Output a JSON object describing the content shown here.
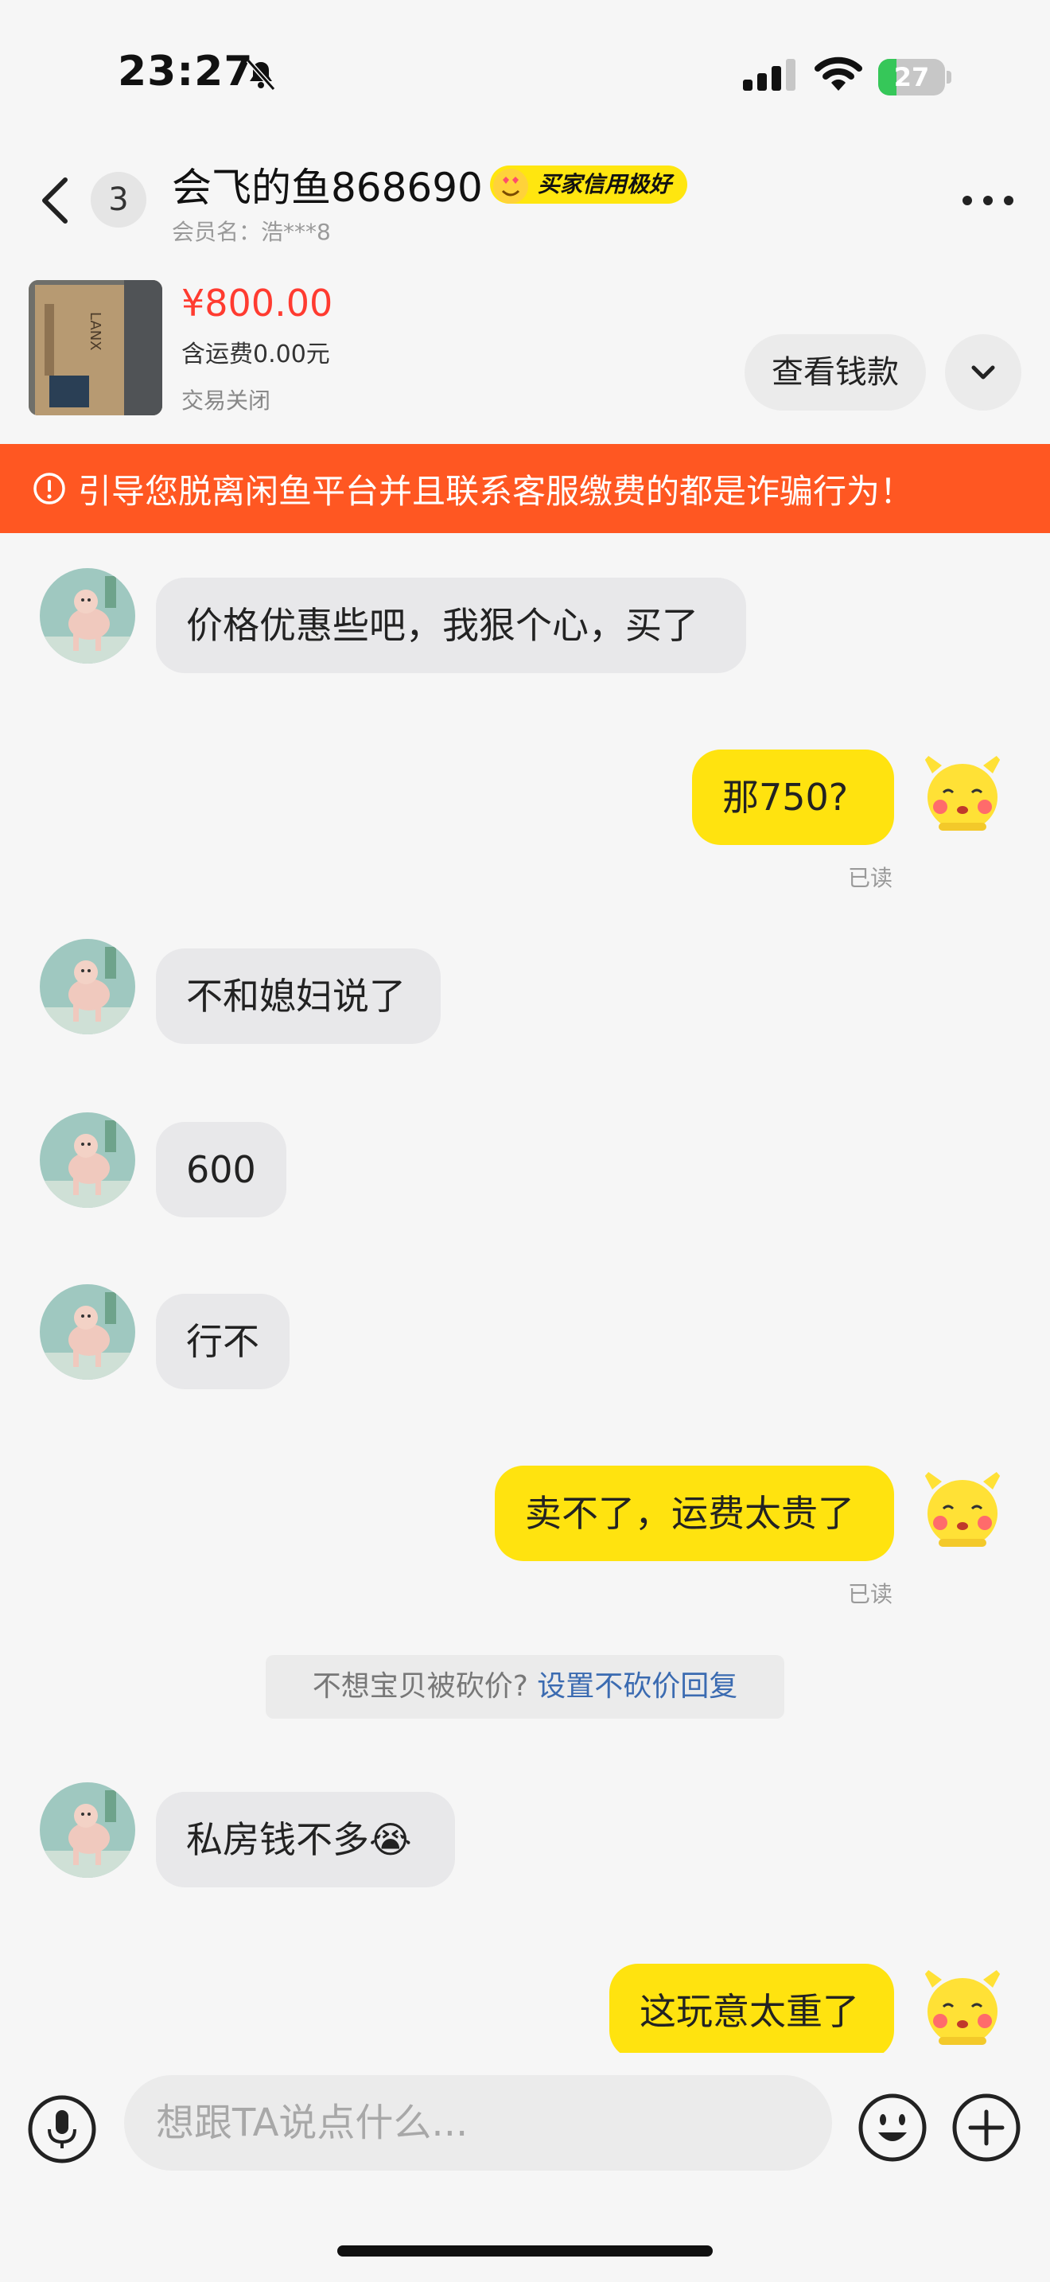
{
  "status_bar": {
    "time": "23:27",
    "battery_level": "27",
    "battery_fraction": 0.27,
    "icons": [
      "bell-slash-icon",
      "cellular-signal-icon",
      "wifi-icon",
      "battery-charging-icon"
    ]
  },
  "header": {
    "unread_count": "3",
    "contact_name": "会飞的鱼868690",
    "credit_badge": "买家信用极好",
    "member_name": "会员名：浩***8",
    "icons": [
      "back-chevron-icon",
      "more-dots-icon",
      "heart-eyes-emoji-icon"
    ]
  },
  "product": {
    "price": "¥800.00",
    "shipping": "含运费0.00元",
    "status": "交易关闭",
    "view_payment_button": "查看钱款"
  },
  "warning": {
    "text": "引导您脱离闲鱼平台并且联系客服缴费的都是诈骗行为！"
  },
  "messages": [
    {
      "from": "them",
      "text": "价格优惠些吧，我狠个心，买了"
    },
    {
      "from": "me",
      "text": "那750?",
      "read": "已读"
    },
    {
      "from": "them",
      "text": "不和媳妇说了"
    },
    {
      "from": "them",
      "text": "600"
    },
    {
      "from": "them",
      "text": "行不"
    },
    {
      "from": "me",
      "text": "卖不了，运费太贵了",
      "read": "已读"
    },
    {
      "from": "them",
      "text": "私房钱不多😭"
    },
    {
      "from": "me",
      "text": "这玩意太重了"
    }
  ],
  "price_hint": {
    "text": "不想宝贝被砍价?",
    "link": "设置不砍价回复"
  },
  "input": {
    "placeholder": "想跟TA说点什么..."
  },
  "colors": {
    "accent_yellow": "#ffe30f",
    "warning_orange": "#ff5722",
    "price_red": "#ff3b30",
    "link_blue": "#3b6bb1"
  }
}
